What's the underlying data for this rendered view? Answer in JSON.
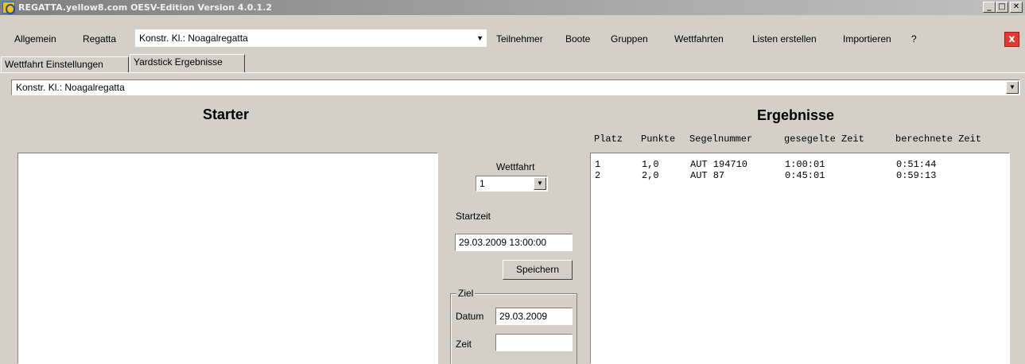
{
  "window": {
    "title": "REGATTA.yellow8.com OESV-Edition Version 4.0.1.2",
    "minimize": "_",
    "maximize": "□",
    "close": "✕"
  },
  "menu": {
    "allgemein": "Allgemein",
    "regatta": "Regatta",
    "class_select": "Konstr. Kl.:  Noagalregatta",
    "teilnehmer": "Teilnehmer",
    "boote": "Boote",
    "gruppen": "Gruppen",
    "wettfahrten": "Wettfahrten",
    "listen": "Listen erstellen",
    "importieren": "Importieren",
    "help": "?",
    "close_app": "x"
  },
  "tabs": {
    "tab1": "Wettfahrt Einstellungen",
    "tab2": "Yardstick Ergebnisse"
  },
  "class_combo": "Konstr. Kl.:  Noagalregatta",
  "starter": {
    "heading": "Starter"
  },
  "middle": {
    "wettfahrt_label": "Wettfahrt",
    "wettfahrt_value": "1",
    "startzeit_label": "Startzeit",
    "startzeit_value": "29.03.2009 13:00:00",
    "save_button": "Speichern",
    "ziel_legend": "Ziel",
    "datum_label": "Datum",
    "datum_value": "29.03.2009",
    "zeit_label": "Zeit",
    "zeit_value": ""
  },
  "results": {
    "heading": "Ergebnisse",
    "columns": {
      "platz": "Platz",
      "punkte": "Punkte",
      "segelnummer": "Segelnummer",
      "gesegelte": "gesegelte Zeit",
      "berechnete": "berechnete Zeit"
    },
    "rows": [
      {
        "platz": "1",
        "punkte": "1,0",
        "segelnummer": "AUT 194710",
        "gesegelte": "1:00:01",
        "berechnete": "0:51:44"
      },
      {
        "platz": "2",
        "punkte": "2,0",
        "segelnummer": "AUT 87",
        "gesegelte": "0:45:01",
        "berechnete": "0:59:13"
      }
    ]
  }
}
